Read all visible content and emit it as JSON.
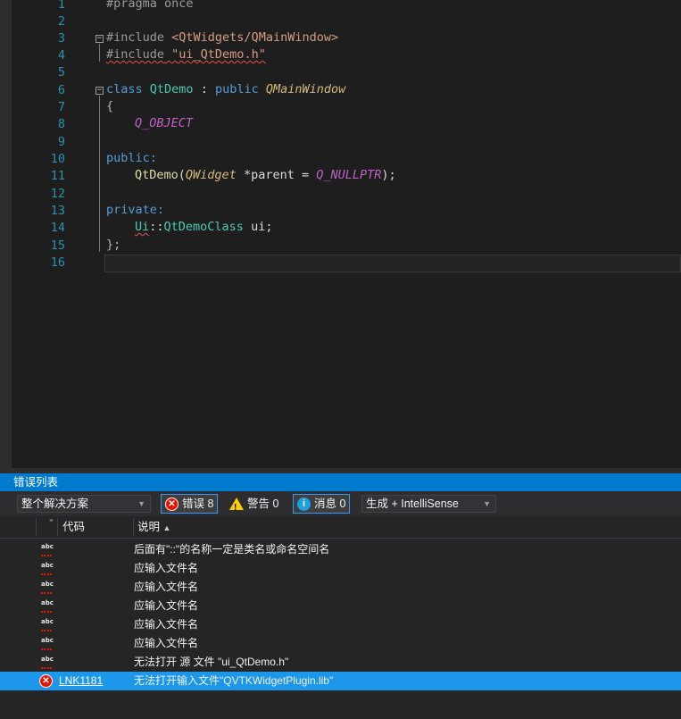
{
  "editor": {
    "line_numbers": [
      "1",
      "2",
      "3",
      "4",
      "5",
      "6",
      "7",
      "8",
      "9",
      "10",
      "11",
      "12",
      "13",
      "14",
      "15",
      "16"
    ],
    "lines": {
      "l1": "#pragma once",
      "l3_a": "#include ",
      "l3_b": "<QtWidgets/QMainWindow>",
      "l4_a": "#include",
      "l4_b": " \"ui_QtDemo.h\"",
      "l6_a": "class ",
      "l6_b": "QtDemo",
      "l6_c": " : ",
      "l6_d": "public ",
      "l6_e": "QMainWindow",
      "l7": "{",
      "l8": "Q_OBJECT",
      "l10": "public:",
      "l11_a": "QtDemo",
      "l11_b": "(",
      "l11_c": "QWidget",
      "l11_d": " *parent = ",
      "l11_e": "Q_NULLPTR",
      "l11_f": ");",
      "l13": "private:",
      "l14_a": "Ui",
      "l14_b": "::",
      "l14_c": "QtDemoClass",
      "l14_d": " ui;",
      "l15": "};"
    }
  },
  "error_list": {
    "title": "错误列表",
    "scope": "整个解决方案",
    "errors_btn": "错误 8",
    "warnings_btn": "警告 0",
    "messages_btn": "消息 0",
    "build_filter": "生成 + IntelliSense",
    "col_code": "代码",
    "col_desc": "说明",
    "rows": [
      {
        "code": "",
        "desc": "后面有\"::\"的名称一定是类名或命名空间名"
      },
      {
        "code": "",
        "desc": "应输入文件名"
      },
      {
        "code": "",
        "desc": "应输入文件名"
      },
      {
        "code": "",
        "desc": "应输入文件名"
      },
      {
        "code": "",
        "desc": "应输入文件名"
      },
      {
        "code": "",
        "desc": "应输入文件名"
      },
      {
        "code": "",
        "desc": "无法打开 源 文件 \"ui_QtDemo.h\""
      },
      {
        "code": "LNK1181",
        "desc": "无法打开输入文件\"QVTKWidgetPlugin.lib\""
      }
    ]
  }
}
